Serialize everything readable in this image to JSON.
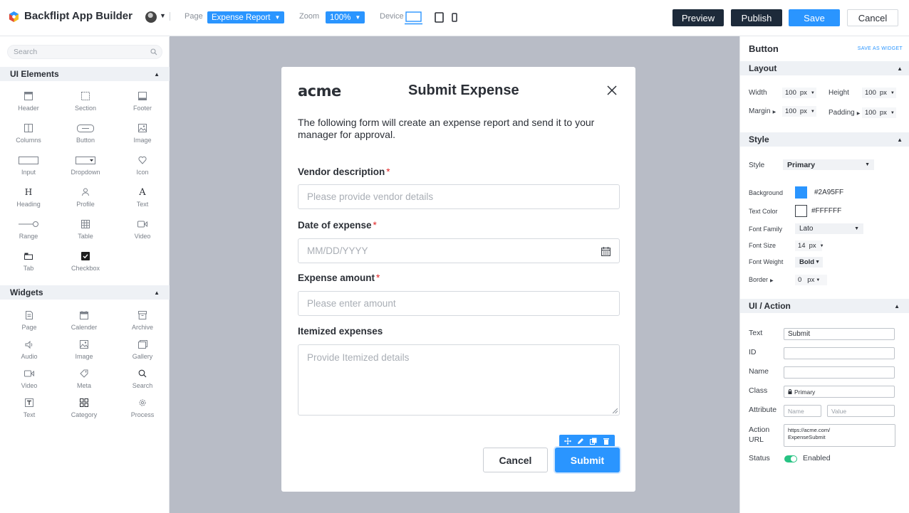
{
  "app": {
    "title": "Backflipt App Builder"
  },
  "header": {
    "page_label": "Page",
    "page_value": "Expense Report",
    "zoom_label": "Zoom",
    "zoom_value": "100%",
    "device_label": "Device",
    "preview": "Preview",
    "publish": "Publish",
    "save": "Save",
    "cancel": "Cancel"
  },
  "left": {
    "search_placeholder": "Search",
    "ui_elements_title": "UI Elements",
    "ui_elements": [
      "Header",
      "Section",
      "Footer",
      "Columns",
      "Button",
      "Image",
      "Input",
      "Dropdown",
      "Icon",
      "Heading",
      "Profile",
      "Text",
      "Range",
      "Table",
      "Video",
      "Tab",
      "Checkbox"
    ],
    "widgets_title": "Widgets",
    "widgets": [
      "Page",
      "Calender",
      "Archive",
      "Audio",
      "Image",
      "Gallery",
      "Video",
      "Meta",
      "Search",
      "Text",
      "Category",
      "Process"
    ]
  },
  "modal": {
    "logo_text": "acme",
    "title": "Submit Expense",
    "description": "The following form will create an expense report and send it to your manager for approval.",
    "required_mark": "*",
    "fields": [
      {
        "label": "Vendor description",
        "placeholder": "Please provide vendor details"
      },
      {
        "label": "Date of expense",
        "placeholder": "MM/DD/YYYY"
      },
      {
        "label": "Expense amount",
        "placeholder": "Please enter amount"
      },
      {
        "label": "Itemized expenses",
        "placeholder": "Provide Itemized details"
      }
    ],
    "cancel": "Cancel",
    "submit": "Submit"
  },
  "right": {
    "title": "Button",
    "save_as_widget": "SAVE AS WIDGET",
    "layout": {
      "title": "Layout",
      "width_label": "Width",
      "width_value": "100",
      "width_unit": "px",
      "height_label": "Height",
      "height_value": "100",
      "height_unit": "px",
      "margin_label": "Margin",
      "margin_value": "100",
      "margin_unit": "px",
      "padding_label": "Padding",
      "padding_value": "100",
      "padding_unit": "px"
    },
    "style": {
      "title": "Style",
      "style_label": "Style",
      "style_value": "Primary",
      "background_label": "Background",
      "background_value": "#2A95FF",
      "text_color_label": "Text Color",
      "text_color_value": "#FFFFFF",
      "font_family_label": "Font Family",
      "font_family_value": "Lato",
      "font_size_label": "Font Size",
      "font_size_value": "14",
      "font_size_unit": "px",
      "font_weight_label": "Font Weight",
      "font_weight_value": "Bold",
      "border_label": "Border",
      "border_value": "0",
      "border_unit": "px"
    },
    "action": {
      "title": "UI / Action",
      "text_label": "Text",
      "text_value": "Submit",
      "id_label": "ID",
      "id_value": "",
      "name_label": "Name",
      "name_value": "",
      "class_label": "Class",
      "class_value": "Primary",
      "attribute_label": "Attribute",
      "attribute_name_placeholder": "Name",
      "attribute_value_placeholder": "Value",
      "action_url_label_1": "Action",
      "action_url_label_2": "URL",
      "action_url_line1": "https://acme.com/",
      "action_url_line2": "ExpenseSubmit",
      "status_label": "Status",
      "status_value": "Enabled"
    }
  },
  "colors": {
    "accent": "#2A95FF",
    "dark_button": "#1D2A3A",
    "canvas_bg": "#B8BCC6",
    "toggle_on": "#27C383"
  }
}
